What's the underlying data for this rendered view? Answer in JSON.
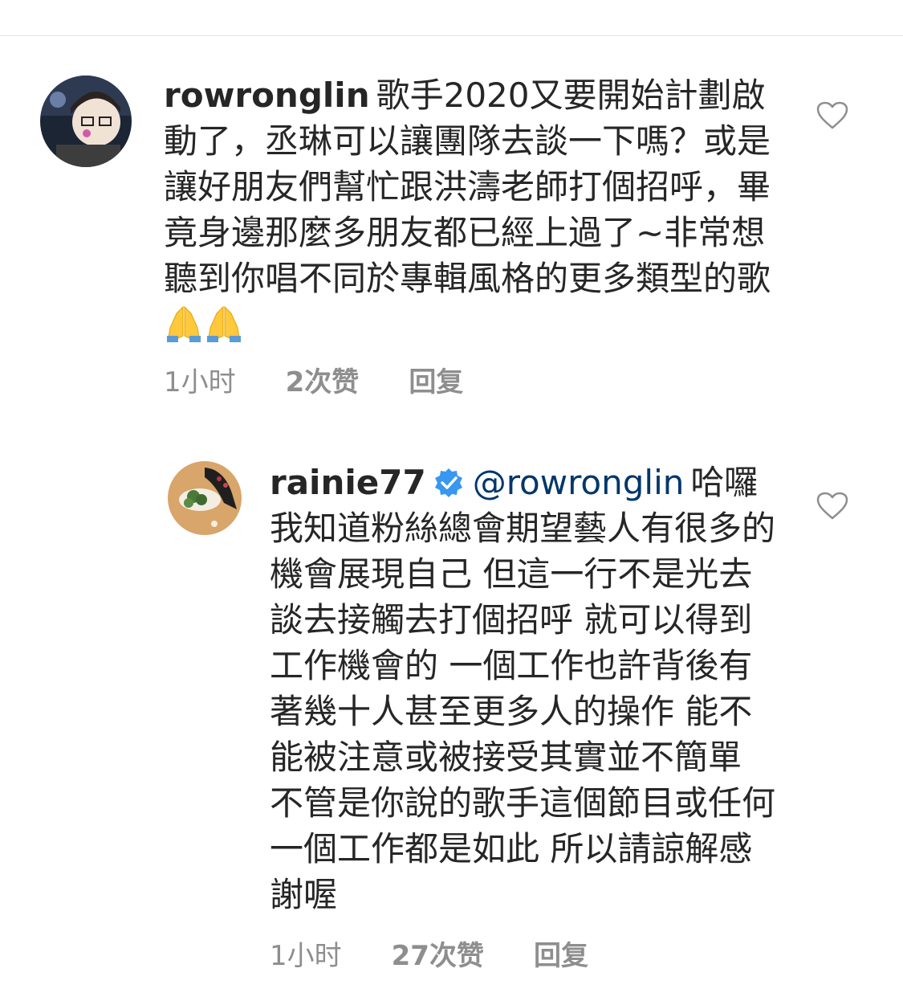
{
  "comments": [
    {
      "username": "rowronglin",
      "mention": "",
      "text": "歌手2020又要開始計劃啟動了，丞琳可以讓團隊去談一下嗎？或是讓好朋友們幫忙跟洪濤老師打個招呼，畢竟身邊那麼多朋友都已經上過了~非常想聽到你唱不同於專輯風格的更多類型的歌",
      "emoji": [
        "folded-hands-emoji",
        "folded-hands-emoji"
      ],
      "time": "1小时",
      "likes": "2次赞",
      "reply_label": "回复",
      "verified": false
    },
    {
      "username": "rainie77",
      "mention": "@rowronglin",
      "text": "哈囉 我知道粉絲總會期望藝人有很多的機會展現自己 但這一行不是光去談去接觸去打個招呼 就可以得到工作機會的 一個工作也許背後有著幾十人甚至更多人的操作 能不能被注意或被接受其實並不簡單 不管是你說的歌手這個節目或任何一個工作都是如此 所以請諒解感謝喔",
      "time": "1小时",
      "likes": "27次赞",
      "reply_label": "回复",
      "verified": true
    }
  ],
  "icons": {
    "heart": "heart-outline-icon",
    "verified": "verified-badge-icon"
  },
  "colors": {
    "text": "#262626",
    "meta": "#8e8e8e",
    "mention": "#00376b",
    "verified": "#3897f0"
  }
}
